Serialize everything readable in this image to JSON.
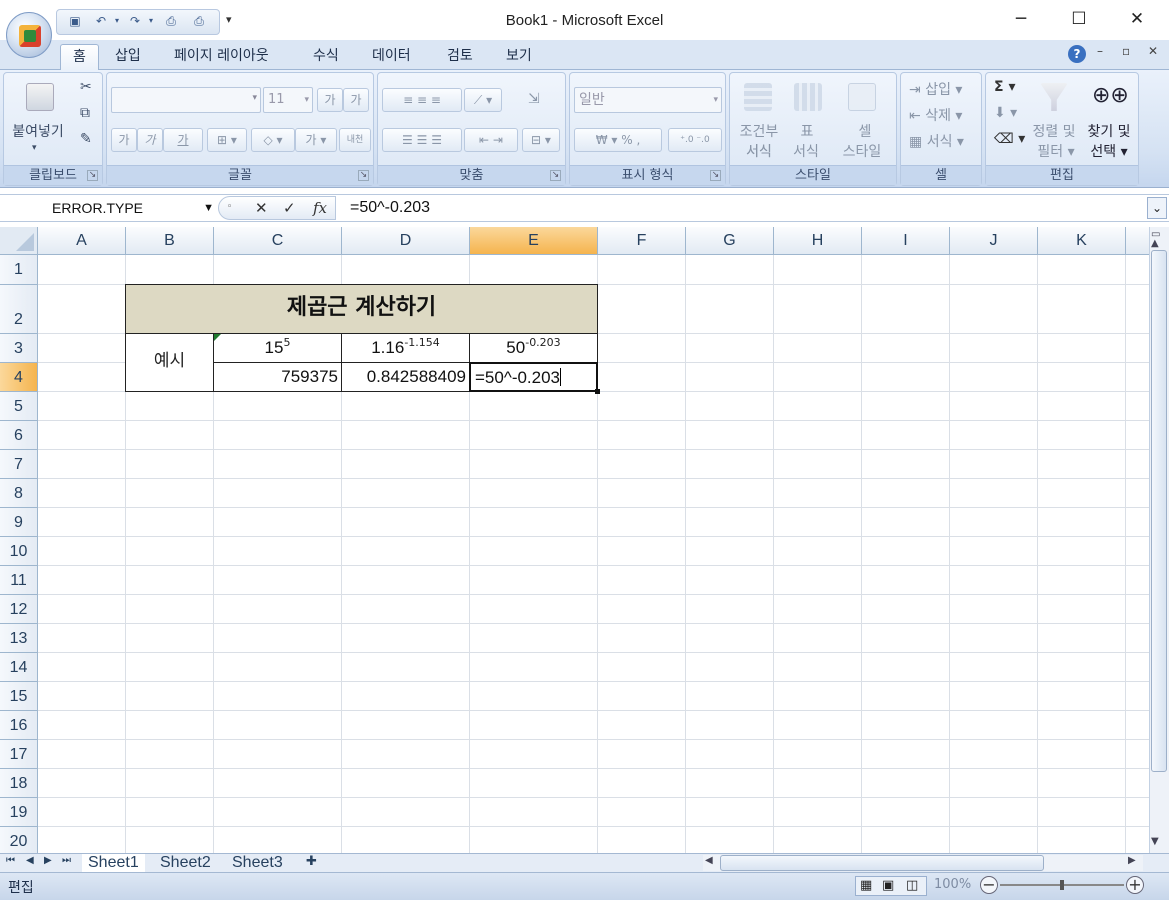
{
  "window": {
    "title": "Book1 - Microsoft Excel",
    "minimize": "─",
    "maximize": "☐",
    "close": "✕"
  },
  "ribbon_tabs": [
    "홈",
    "삽입",
    "페이지 레이아웃",
    "수식",
    "데이터",
    "검토",
    "보기"
  ],
  "ribbon": {
    "clipboard": {
      "paste": "붙여넣기",
      "label": "클립보드"
    },
    "font": {
      "name": "",
      "size": "11",
      "grow": "가",
      "shrink": "가",
      "bold": "가",
      "italic": "가",
      "underline": "가",
      "font_color": "가",
      "label": "글꼴",
      "phonetic": "내천"
    },
    "alignment": {
      "label": "맞춤"
    },
    "number": {
      "format": "일반",
      "currency": "₩",
      "percent": "%",
      "comma": ",",
      "label": "표시 형식"
    },
    "styles": {
      "conditional": "조건부 서식",
      "conditional_sub": "서식",
      "table": "표",
      "table_sub": "서식",
      "cell_style": "셀",
      "cell_style_sub": "스타일",
      "label": "스타일"
    },
    "cells": {
      "insert": "삽입",
      "delete": "삭제",
      "format": "서식",
      "label": "셀"
    },
    "editing": {
      "sort": "정렬 및",
      "sort_sub": "필터",
      "find": "찾기 및",
      "find_sub": "선택",
      "label": "편집",
      "sum": "Σ"
    }
  },
  "formula_bar": {
    "name_box": "ERROR.TYPE",
    "formula": "=50^-0.203",
    "fx": "fx"
  },
  "columns": [
    "A",
    "B",
    "C",
    "D",
    "E",
    "F",
    "G",
    "H",
    "I",
    "J",
    "K"
  ],
  "rows": [
    "1",
    "2",
    "3",
    "4",
    "5",
    "6",
    "7",
    "8",
    "9",
    "10",
    "11",
    "12",
    "13",
    "14",
    "15",
    "16",
    "17",
    "18",
    "19",
    "20"
  ],
  "selected_column": "E",
  "selected_row": "4",
  "cells": {
    "title": "제곱근 계산하기",
    "example_label": "예시",
    "c3_base": "15",
    "c3_exp": "5",
    "d3_base": "1.16",
    "d3_exp": "-1.154",
    "e3_base": "50",
    "e3_exp": "-0.203",
    "c4": "759375",
    "d4": "0.842588409",
    "e4": "=50^-0.203"
  },
  "sheets": [
    "Sheet1",
    "Sheet2",
    "Sheet3"
  ],
  "active_sheet": "Sheet1",
  "status": {
    "mode": "편집",
    "zoom": "100%"
  },
  "colors": {
    "title_fill": "#ddd9c3",
    "selected_header": "#f5b44e",
    "ribbon_bg": "#dbe6f4"
  }
}
